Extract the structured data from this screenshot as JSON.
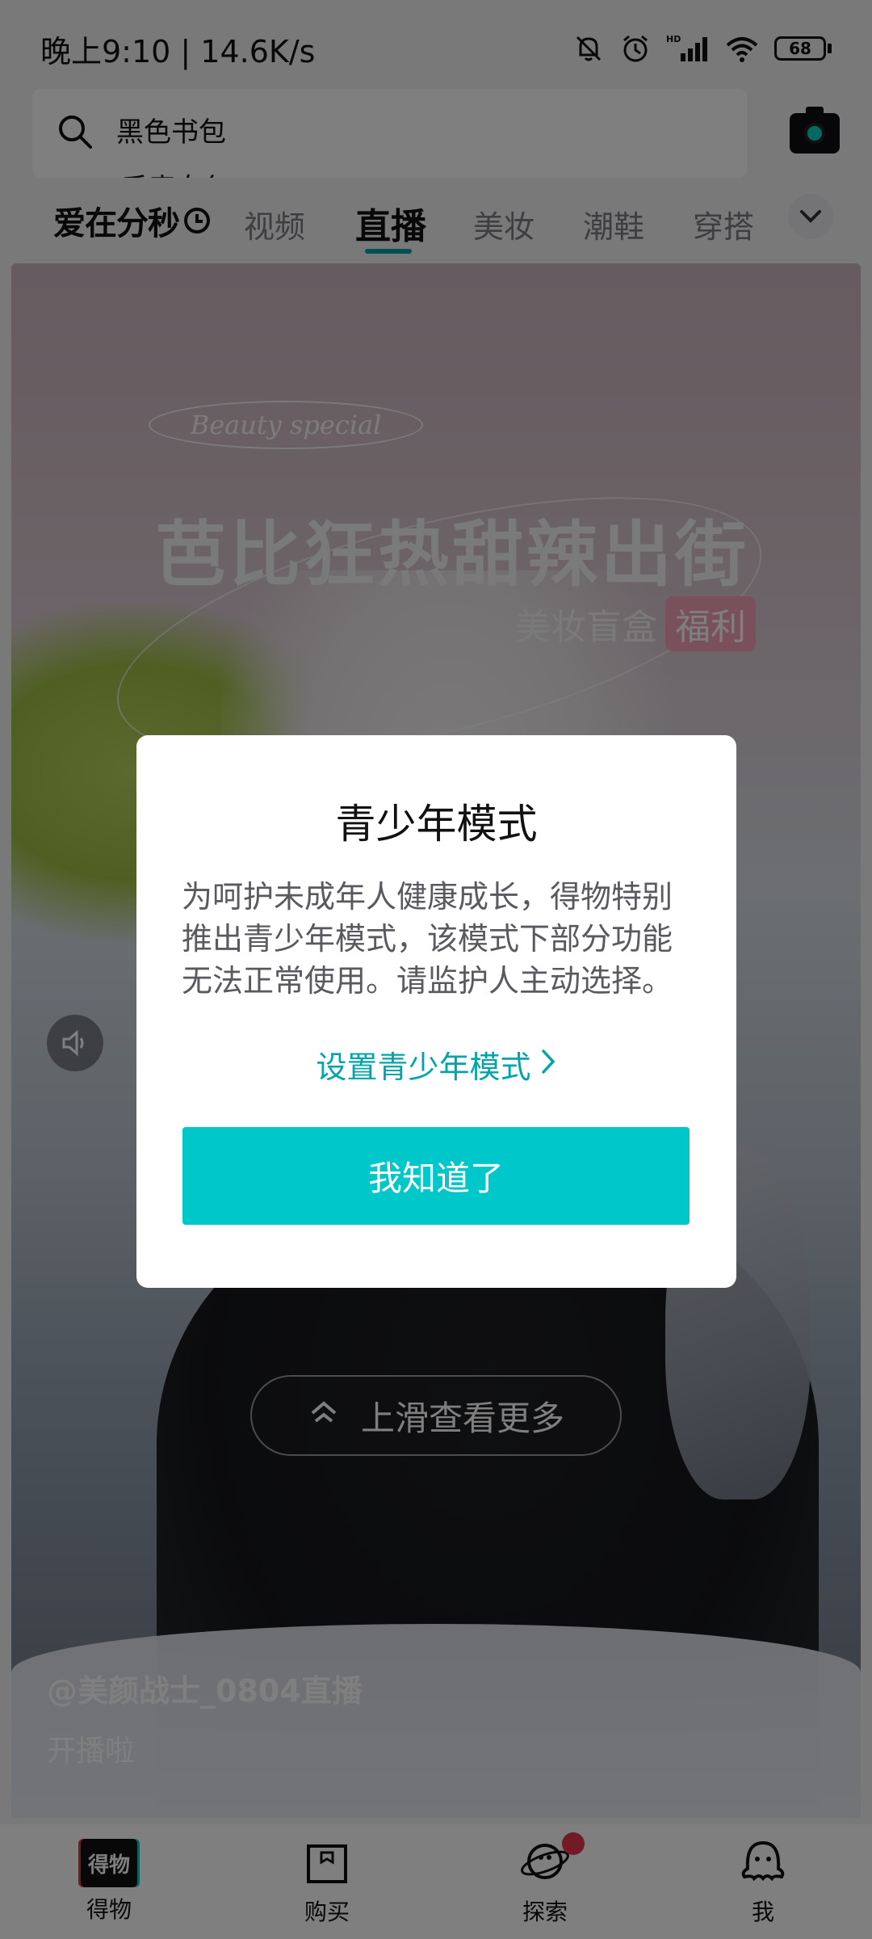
{
  "status_bar": {
    "time_speed": "晚上9:10 | 14.6K/s",
    "battery": "68",
    "icons": [
      "mute-bell-icon",
      "alarm-icon",
      "hd-signal-icon",
      "wifi-icon",
      "battery-icon"
    ]
  },
  "search": {
    "placeholder_current": "黑色书包",
    "placeholder_next": "手表女包",
    "icon": "search-icon",
    "camera_icon": "camera-icon"
  },
  "tabs": {
    "special": "爱在分秒",
    "items": [
      "视频",
      "直播",
      "美妆",
      "潮鞋",
      "穿搭"
    ],
    "active": "直播",
    "more_icon": "chevron-down-icon"
  },
  "feed": {
    "promo_script": "Beauty special",
    "promo_title": "芭比狂热甜辣出街",
    "promo_sub": "美妆盲盒",
    "promo_badge": "福利",
    "swipe_hint": "上滑查看更多",
    "streamer": "@美颜战士_0804直播",
    "status": "开播啦"
  },
  "bottom_nav": {
    "items": [
      {
        "label": "得物",
        "icon": "dewu-logo-icon"
      },
      {
        "label": "购买",
        "icon": "shopping-bag-icon"
      },
      {
        "label": "探索",
        "icon": "planet-icon"
      },
      {
        "label": "我",
        "icon": "profile-icon"
      }
    ],
    "logo_text": "得物"
  },
  "dialog": {
    "title": "青少年模式",
    "body": "为呵护未成年人健康成长，得物特别推出青少年模式，该模式下部分功能无法正常使用。请监护人主动选择。",
    "link": "设置青少年模式",
    "button": "我知道了"
  },
  "colors": {
    "accent": "#00c7c9",
    "link": "#00a5ab",
    "badge_red": "#e5354b"
  }
}
